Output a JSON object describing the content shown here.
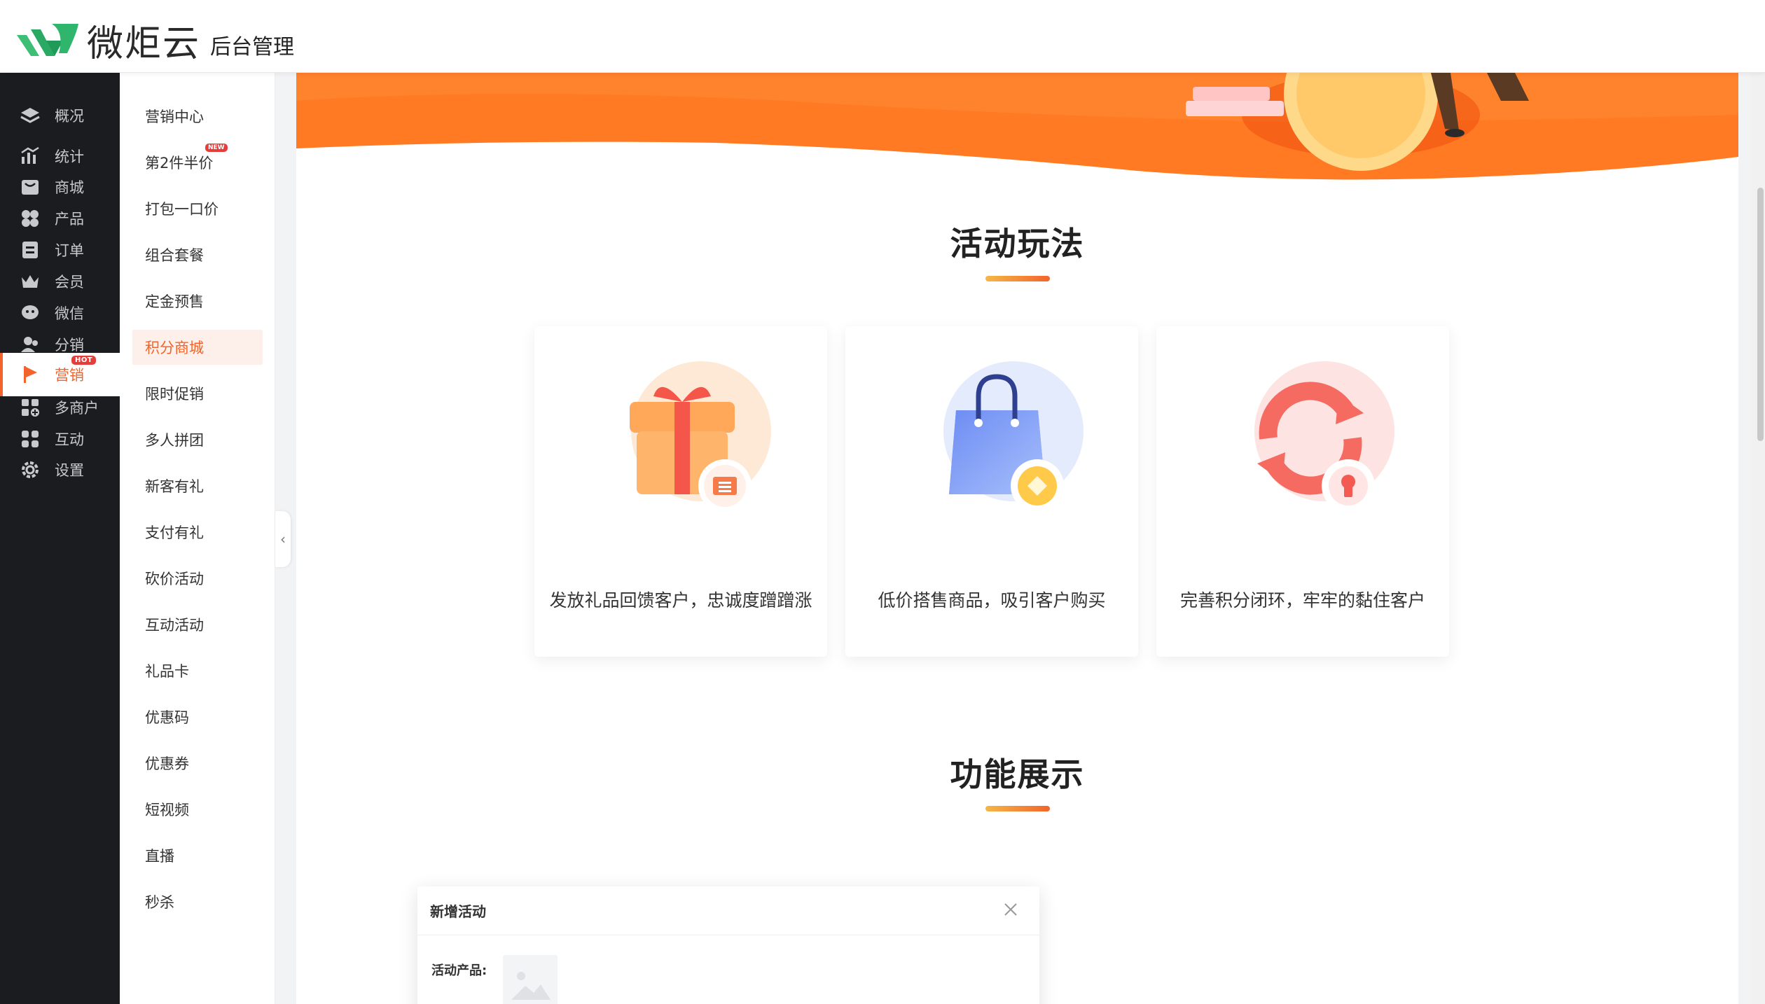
{
  "header": {
    "brand_name": "微炬云",
    "brand_sub": "后台管理"
  },
  "sidebar": {
    "items": [
      {
        "label": "概况",
        "icon": "layers-icon"
      },
      {
        "label": "统计",
        "icon": "chart-icon"
      },
      {
        "label": "商城",
        "icon": "store-icon"
      },
      {
        "label": "产品",
        "icon": "grid-icon"
      },
      {
        "label": "订单",
        "icon": "order-icon"
      },
      {
        "label": "会员",
        "icon": "crown-icon"
      },
      {
        "label": "微信",
        "icon": "wechat-icon"
      },
      {
        "label": "分销",
        "icon": "users-icon"
      },
      {
        "label": "营销",
        "icon": "flag-icon",
        "badge": "HOT",
        "active": true
      },
      {
        "label": "多商户",
        "icon": "shop-plus-icon"
      },
      {
        "label": "互动",
        "icon": "interact-icon"
      },
      {
        "label": "设置",
        "icon": "gear-icon"
      }
    ]
  },
  "submenu": {
    "items": [
      {
        "label": "营销中心"
      },
      {
        "label": "第2件半价",
        "badge": "NEW"
      },
      {
        "label": "打包一口价"
      },
      {
        "label": "组合套餐"
      },
      {
        "label": "定金预售"
      },
      {
        "label": "积分商城",
        "active": true
      },
      {
        "label": "限时促销"
      },
      {
        "label": "多人拼团"
      },
      {
        "label": "新客有礼"
      },
      {
        "label": "支付有礼"
      },
      {
        "label": "砍价活动"
      },
      {
        "label": "互动活动"
      },
      {
        "label": "礼品卡"
      },
      {
        "label": "优惠码"
      },
      {
        "label": "优惠券"
      },
      {
        "label": "短视频"
      },
      {
        "label": "直播"
      },
      {
        "label": "秒杀"
      }
    ]
  },
  "main": {
    "section1_title": "活动玩法",
    "cards": [
      {
        "text": "发放礼品回馈客户，忠诚度蹭蹭涨",
        "icon": "gift-icon"
      },
      {
        "text": "低价搭售商品，吸引客户购买",
        "icon": "shopping-bag-icon"
      },
      {
        "text": "完善积分闭环，牢牢的黏住客户",
        "icon": "cycle-icon"
      }
    ],
    "section2_title": "功能展示",
    "dialog": {
      "title": "新增活动",
      "label": "活动产品:"
    }
  },
  "colors": {
    "accent": "#f2642c",
    "banner": "#ff7a22",
    "sidebar_bg": "#1b1c1f"
  }
}
